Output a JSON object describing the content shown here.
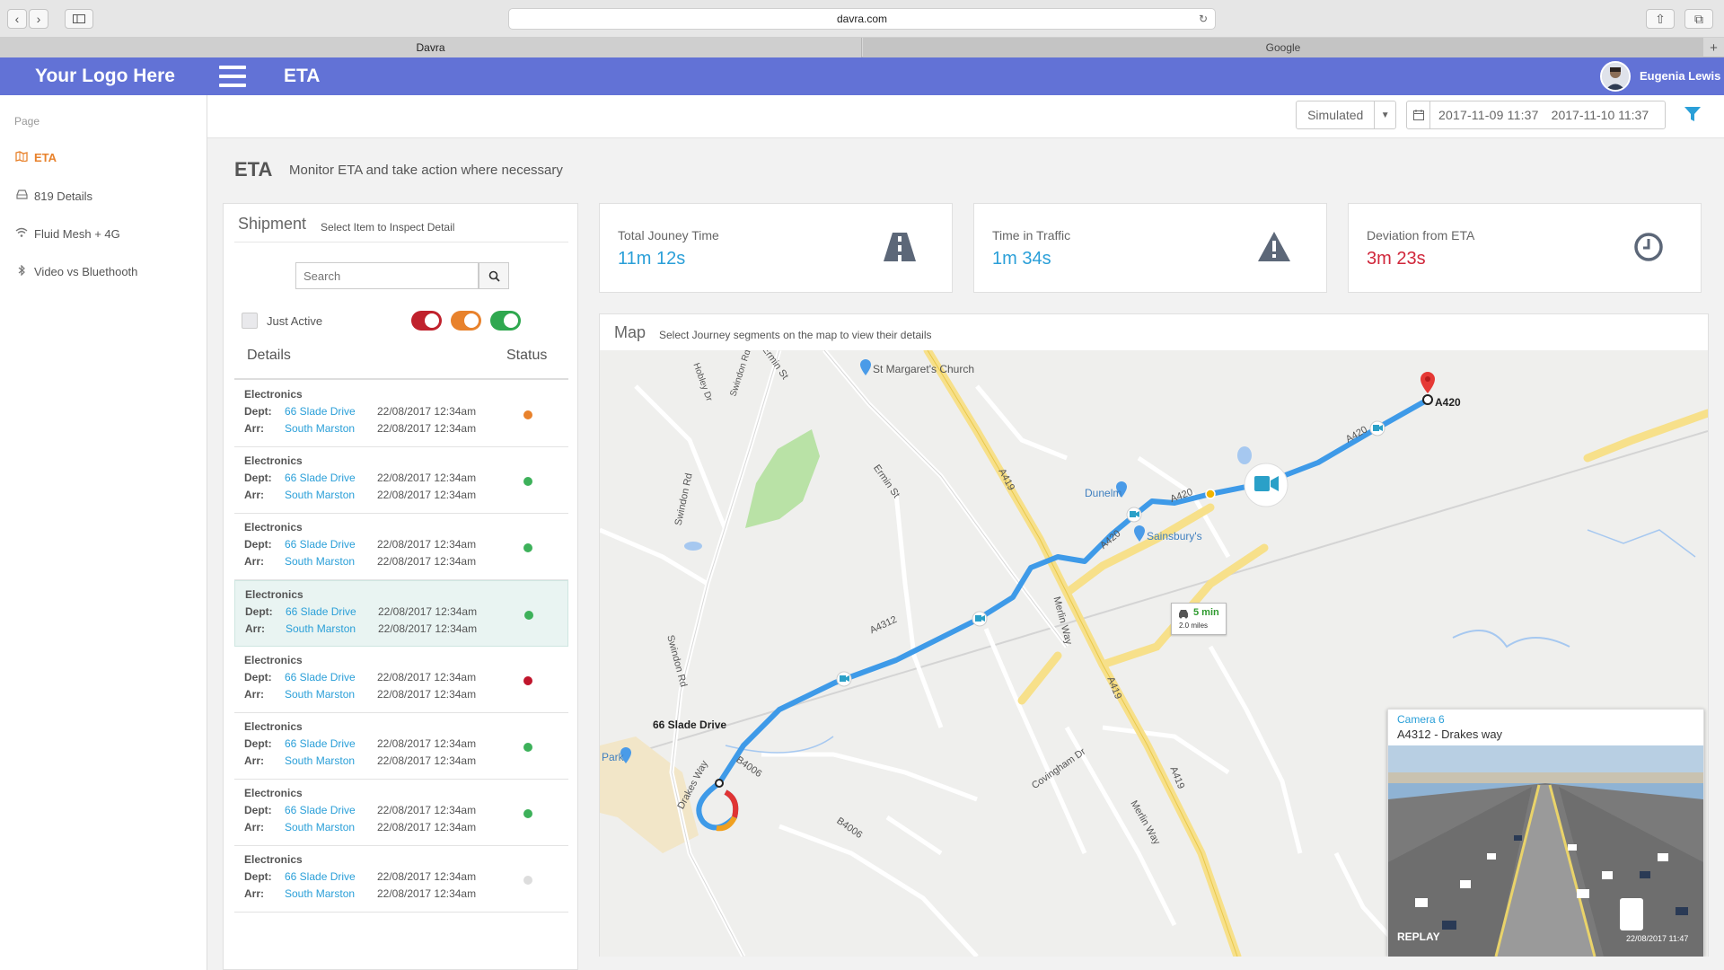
{
  "browser": {
    "url": "davra.com",
    "tabs": [
      {
        "label": "Davra"
      },
      {
        "label": "Google"
      }
    ]
  },
  "header": {
    "logo": "Your Logo Here",
    "title": "ETA",
    "user": "Eugenia Lewis"
  },
  "sidebar": {
    "section": "Page",
    "items": [
      {
        "label": "ETA",
        "icon": "map-icon",
        "active": true
      },
      {
        "label": "819 Details",
        "icon": "inbox-icon"
      },
      {
        "label": "Fluid Mesh + 4G",
        "icon": "wifi-icon"
      },
      {
        "label": "Video vs Bluethooth",
        "icon": "bluetooth-icon"
      }
    ]
  },
  "toolbar": {
    "mode": "Simulated",
    "date_from": "2017-11-09  11:37",
    "date_to": "2017-11-10  11:37"
  },
  "page": {
    "title": "ETA",
    "subtitle": "Monitor ETA and take action where necessary"
  },
  "shipment": {
    "title": "Shipment",
    "hint": "Select Item to Inspect Detail",
    "search_placeholder": "Search",
    "just_active": "Just Active",
    "col_details": "Details",
    "col_status": "Status",
    "dept_label": "Dept:",
    "arr_label": "Arr:",
    "toggle_colors": [
      "#c0212c",
      "#e8822c",
      "#2fa84f"
    ],
    "rows": [
      {
        "category": "Electronics",
        "dept": "66 Slade Drive",
        "dept_time": "22/08/2017 12:34am",
        "arr": "South Marston",
        "arr_time": "22/08/2017 12:34am",
        "status_color": "#e8822c"
      },
      {
        "category": "Electronics",
        "dept": "66 Slade Drive",
        "dept_time": "22/08/2017 12:34am",
        "arr": "South Marston",
        "arr_time": "22/08/2017 12:34am",
        "status_color": "#3db15a"
      },
      {
        "category": "Electronics",
        "dept": "66 Slade Drive",
        "dept_time": "22/08/2017 12:34am",
        "arr": "South Marston",
        "arr_time": "22/08/2017 12:34am",
        "status_color": "#3db15a"
      },
      {
        "category": "Electronics",
        "dept": "66 Slade Drive",
        "dept_time": "22/08/2017 12:34am",
        "arr": "South Marston",
        "arr_time": "22/08/2017 12:34am",
        "status_color": "#3db15a",
        "selected": true
      },
      {
        "category": "Electronics",
        "dept": "66 Slade Drive",
        "dept_time": "22/08/2017 12:34am",
        "arr": "South Marston",
        "arr_time": "22/08/2017 12:34am",
        "status_color": "#c0152c"
      },
      {
        "category": "Electronics",
        "dept": "66 Slade Drive",
        "dept_time": "22/08/2017 12:34am",
        "arr": "South Marston",
        "arr_time": "22/08/2017 12:34am",
        "status_color": "#3db15a"
      },
      {
        "category": "Electronics",
        "dept": "66 Slade Drive",
        "dept_time": "22/08/2017 12:34am",
        "arr": "South Marston",
        "arr_time": "22/08/2017 12:34am",
        "status_color": "#3db15a"
      },
      {
        "category": "Electronics",
        "dept": "66 Slade Drive",
        "dept_time": "22/08/2017 12:34am",
        "arr": "South Marston",
        "arr_time": "22/08/2017 12:34am",
        "status_color": "#dddddd"
      }
    ]
  },
  "kpis": [
    {
      "label": "Total Jouney Time",
      "value": "11m 12s",
      "icon": "road-icon",
      "color": "#2a9fd8"
    },
    {
      "label": "Time in Traffic",
      "value": "1m 34s",
      "icon": "warning-icon",
      "color": "#2a9fd8"
    },
    {
      "label": "Deviation from ETA",
      "value": "3m 23s",
      "icon": "clock-icon",
      "color": "#d0263a"
    }
  ],
  "map": {
    "title": "Map",
    "hint": "Select Journey segments on the map to view their details",
    "labels": {
      "church": "St Margaret's Church",
      "dunelm": "Dunelm",
      "sainsburys": "Sainsbury's",
      "start": "66 Slade Drive",
      "end": "A420",
      "park": "Park",
      "road_a419a": "A419",
      "road_a419b": "A419",
      "road_a419c": "A419",
      "road_a420a": "A420",
      "road_a420b": "A420",
      "road_a420c": "A420",
      "road_a4312": "A4312",
      "road_b4006a": "B4006",
      "road_b4006b": "B4006",
      "swindon_rd_a": "Swindon Rd",
      "swindon_rd_b": "Swindon Rd",
      "ermin_st_a": "Ermin St",
      "ermin_st_b": "Ermin St",
      "merlin_way_a": "Merlin Way",
      "merlin_way_b": "Merlin Way",
      "drakes_way": "Drakes Way",
      "covingham_dr": "Covingham Dr",
      "hobley_dr": "Hobley Dr",
      "swindon_rd2": "Swindon Rd"
    },
    "traffic": {
      "time": "5 min",
      "distance": "2.0 miles"
    },
    "camera": {
      "name": "Camera 6",
      "location": "A4312 - Drakes way",
      "replay": "REPLAY",
      "timestamp": "22/08/2017 11:47"
    }
  }
}
